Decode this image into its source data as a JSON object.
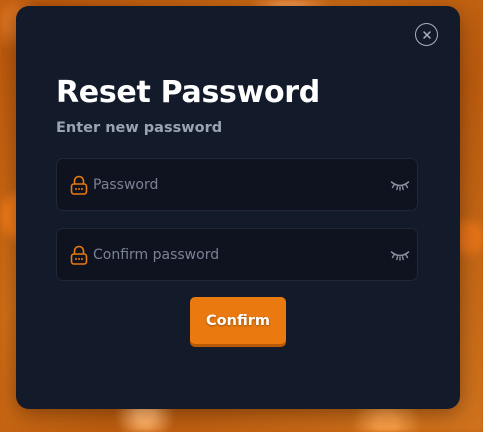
{
  "modal": {
    "title": "Reset Password",
    "subtitle": "Enter new password"
  },
  "fields": [
    {
      "placeholder": "Password",
      "value": "",
      "icon": "lock-icon",
      "toggle_icon": "eye-closed-icon"
    },
    {
      "placeholder": "Confirm password",
      "value": "",
      "icon": "lock-icon",
      "toggle_icon": "eye-closed-icon"
    }
  ],
  "actions": {
    "confirm_label": "Confirm",
    "close_icon": "close-icon"
  },
  "colors": {
    "modal_bg": "#131a2a",
    "field_bg": "#0e131f",
    "accent": "#ea7a10",
    "subtitle": "#9aa3b4",
    "backdrop": "#c4620f"
  }
}
